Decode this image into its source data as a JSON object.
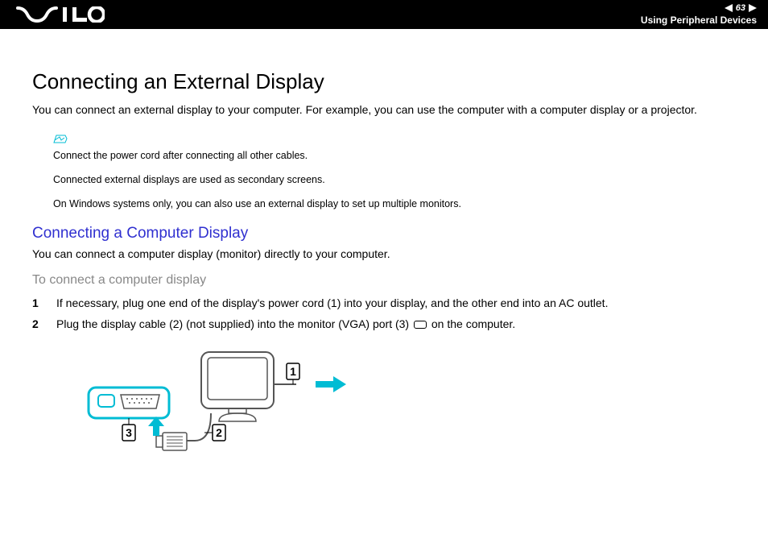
{
  "header": {
    "page_number": "63",
    "section": "Using Peripheral Devices"
  },
  "title": "Connecting an External Display",
  "intro": "You can connect an external display to your computer. For example, you can use the computer with a computer display or a projector.",
  "notes": {
    "line1": "Connect the power cord after connecting all other cables.",
    "line2": "Connected external displays are used as secondary screens.",
    "line3": "On Windows systems only, you can also use an external display to set up multiple monitors."
  },
  "subheading": "Connecting a Computer Display",
  "sub_intro": "You can connect a computer display (monitor) directly to your computer.",
  "procedure_heading": "To connect a computer display",
  "steps": {
    "s1_num": "1",
    "s1_text": "If necessary, plug one end of the display's power cord (1) into your display, and the other end into an AC outlet.",
    "s2_num": "2",
    "s2_text_a": "Plug the display cable (2) (not supplied) into the monitor (VGA) port (3) ",
    "s2_text_b": " on the computer."
  },
  "diagram": {
    "label1": "1",
    "label2": "2",
    "label3": "3"
  }
}
